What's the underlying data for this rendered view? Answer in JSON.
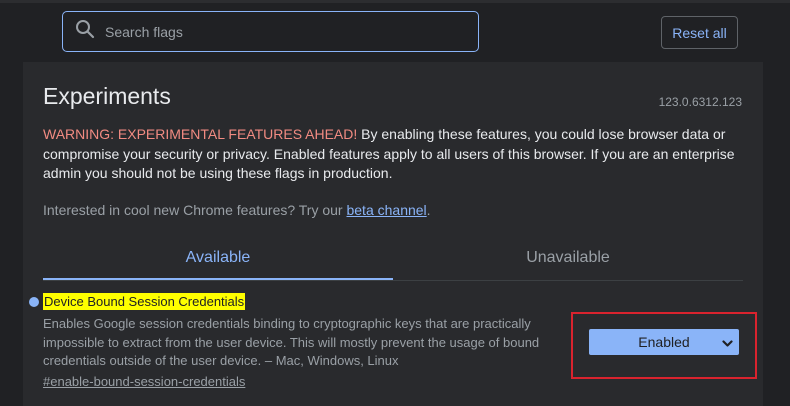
{
  "search": {
    "placeholder": "Search flags"
  },
  "toolbar": {
    "reset_label": "Reset all"
  },
  "page": {
    "title": "Experiments",
    "version": "123.0.6312.123",
    "warning_prefix": "WARNING: EXPERIMENTAL FEATURES AHEAD!",
    "warning_text": " By enabling these features, you could lose browser data or compromise your security or privacy. Enabled features apply to all users of this browser. If you are an enterprise admin you should not be using these flags in production.",
    "interested_text": "Interested in cool new Chrome features? Try our ",
    "beta_link": "beta channel",
    "interested_suffix": "."
  },
  "tabs": [
    {
      "label": "Available",
      "active": true
    },
    {
      "label": "Unavailable",
      "active": false
    }
  ],
  "flag": {
    "name": "Device Bound Session Credentials",
    "description": "Enables Google session credentials binding to cryptographic keys that are practically impossible to extract from the user device. This will mostly prevent the usage of bound credentials outside of the user device. – Mac, Windows, Linux",
    "anchor": "#enable-bound-session-credentials",
    "state": "Enabled"
  },
  "colors": {
    "accent": "#8ab4f8",
    "warning": "#f28b82",
    "highlight": "#ffff00",
    "annotation_box": "#d9232e"
  },
  "icons": {
    "search": "search-icon",
    "dropdown": "chevron-down-icon"
  }
}
